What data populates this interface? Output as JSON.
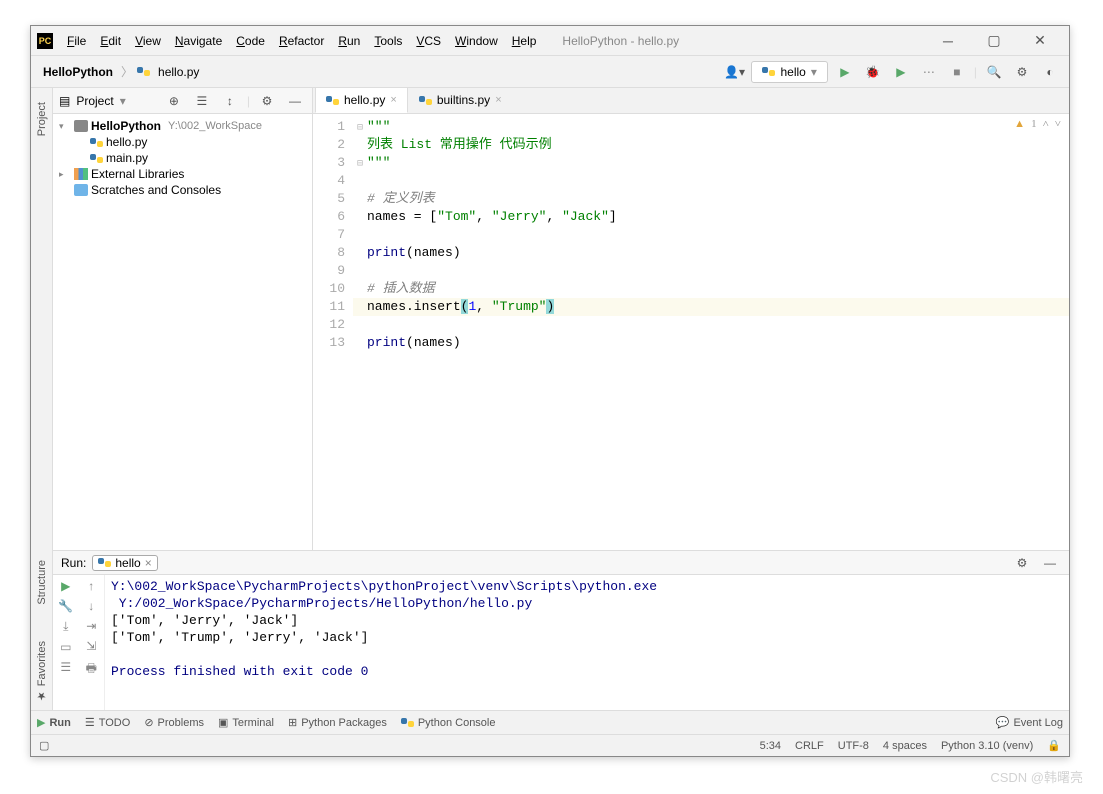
{
  "title": "HelloPython - hello.py",
  "menu": [
    "File",
    "Edit",
    "View",
    "Navigate",
    "Code",
    "Refactor",
    "Run",
    "Tools",
    "VCS",
    "Window",
    "Help"
  ],
  "breadcrumb": {
    "root": "HelloPython",
    "file": "hello.py"
  },
  "runconfig": {
    "name": "hello"
  },
  "project_header": "Project",
  "tree": {
    "root": {
      "name": "HelloPython",
      "path": "Y:\\002_WorkSpace"
    },
    "files": [
      "hello.py",
      "main.py"
    ],
    "ext_lib": "External Libraries",
    "scratches": "Scratches and Consoles"
  },
  "tabs": [
    {
      "name": "hello.py",
      "active": true
    },
    {
      "name": "builtins.py",
      "active": false
    }
  ],
  "code": {
    "lines": [
      {
        "n": 1,
        "raw": "\"\"\"",
        "html": "<span class='fold'>⊟</span><span class='kw-str'>\"\"\"</span>"
      },
      {
        "n": 2,
        "raw": "列表 List 常用操作 代码示例",
        "html": "<span class='fold'></span><span class='kw-str'>列表 List 常用操作 代码示例</span>"
      },
      {
        "n": 3,
        "raw": "\"\"\"",
        "html": "<span class='fold'>⊟</span><span class='kw-str'>\"\"\"</span>"
      },
      {
        "n": 4,
        "raw": "",
        "html": "<span class='fold'></span>"
      },
      {
        "n": 5,
        "raw": "# 定义列表",
        "html": "<span class='fold'></span><span class='kw-comment'># 定义列表</span>"
      },
      {
        "n": 6,
        "raw": "names = [\"Tom\", \"Jerry\", \"Jack\"]",
        "html": "<span class='fold'></span><span class='kw-name'>names = [</span><span class='kw-str'>\"Tom\"</span>, <span class='kw-str'>\"Jerry\"</span>, <span class='kw-str'>\"Jack\"</span>]"
      },
      {
        "n": 7,
        "raw": "",
        "html": "<span class='fold'></span>"
      },
      {
        "n": 8,
        "raw": "print(names)",
        "html": "<span class='fold'></span><span class='kw-func'>print</span>(names)"
      },
      {
        "n": 9,
        "raw": "",
        "html": "<span class='fold'></span>"
      },
      {
        "n": 10,
        "raw": "# 插入数据",
        "html": "<span class='fold'></span><span class='kw-comment'># 插入数据</span>"
      },
      {
        "n": 11,
        "raw": "names.insert(1, \"Trump\")",
        "html": "<span class='fold'></span>names.insert<span class='paren-match'>(</span><span class='kw-num'>1</span>, <span class='kw-str'>\"Trump\"</span><span class='paren-match'>)</span>",
        "highlight": true
      },
      {
        "n": 12,
        "raw": "",
        "html": "<span class='fold'></span>"
      },
      {
        "n": 13,
        "raw": "print(names)",
        "html": "<span class='fold'></span><span class='kw-func'>print</span>(names)"
      }
    ],
    "warnings": "1"
  },
  "run": {
    "label": "Run:",
    "tab": "hello",
    "output": [
      {
        "cls": "cblue",
        "text": "Y:\\002_WorkSpace\\PycharmProjects\\pythonProject\\venv\\Scripts\\python.exe"
      },
      {
        "cls": "cblue",
        "text": " Y:/002_WorkSpace/PycharmProjects/HelloPython/hello.py"
      },
      {
        "cls": "",
        "text": "['Tom', 'Jerry', 'Jack']"
      },
      {
        "cls": "",
        "text": "['Tom', 'Trump', 'Jerry', 'Jack']"
      },
      {
        "cls": "",
        "text": ""
      },
      {
        "cls": "cblue",
        "text": "Process finished with exit code 0"
      }
    ]
  },
  "bottom": {
    "run": "Run",
    "todo": "TODO",
    "problems": "Problems",
    "terminal": "Terminal",
    "pkgs": "Python Packages",
    "console": "Python Console",
    "eventlog": "Event Log"
  },
  "status": {
    "pos": "5:34",
    "lineend": "CRLF",
    "enc": "UTF-8",
    "indent": "4 spaces",
    "interp": "Python 3.10 (venv)"
  },
  "sidebar": {
    "project": "Project",
    "structure": "Structure",
    "favorites": "Favorites"
  },
  "watermark": "CSDN @韩曙亮"
}
